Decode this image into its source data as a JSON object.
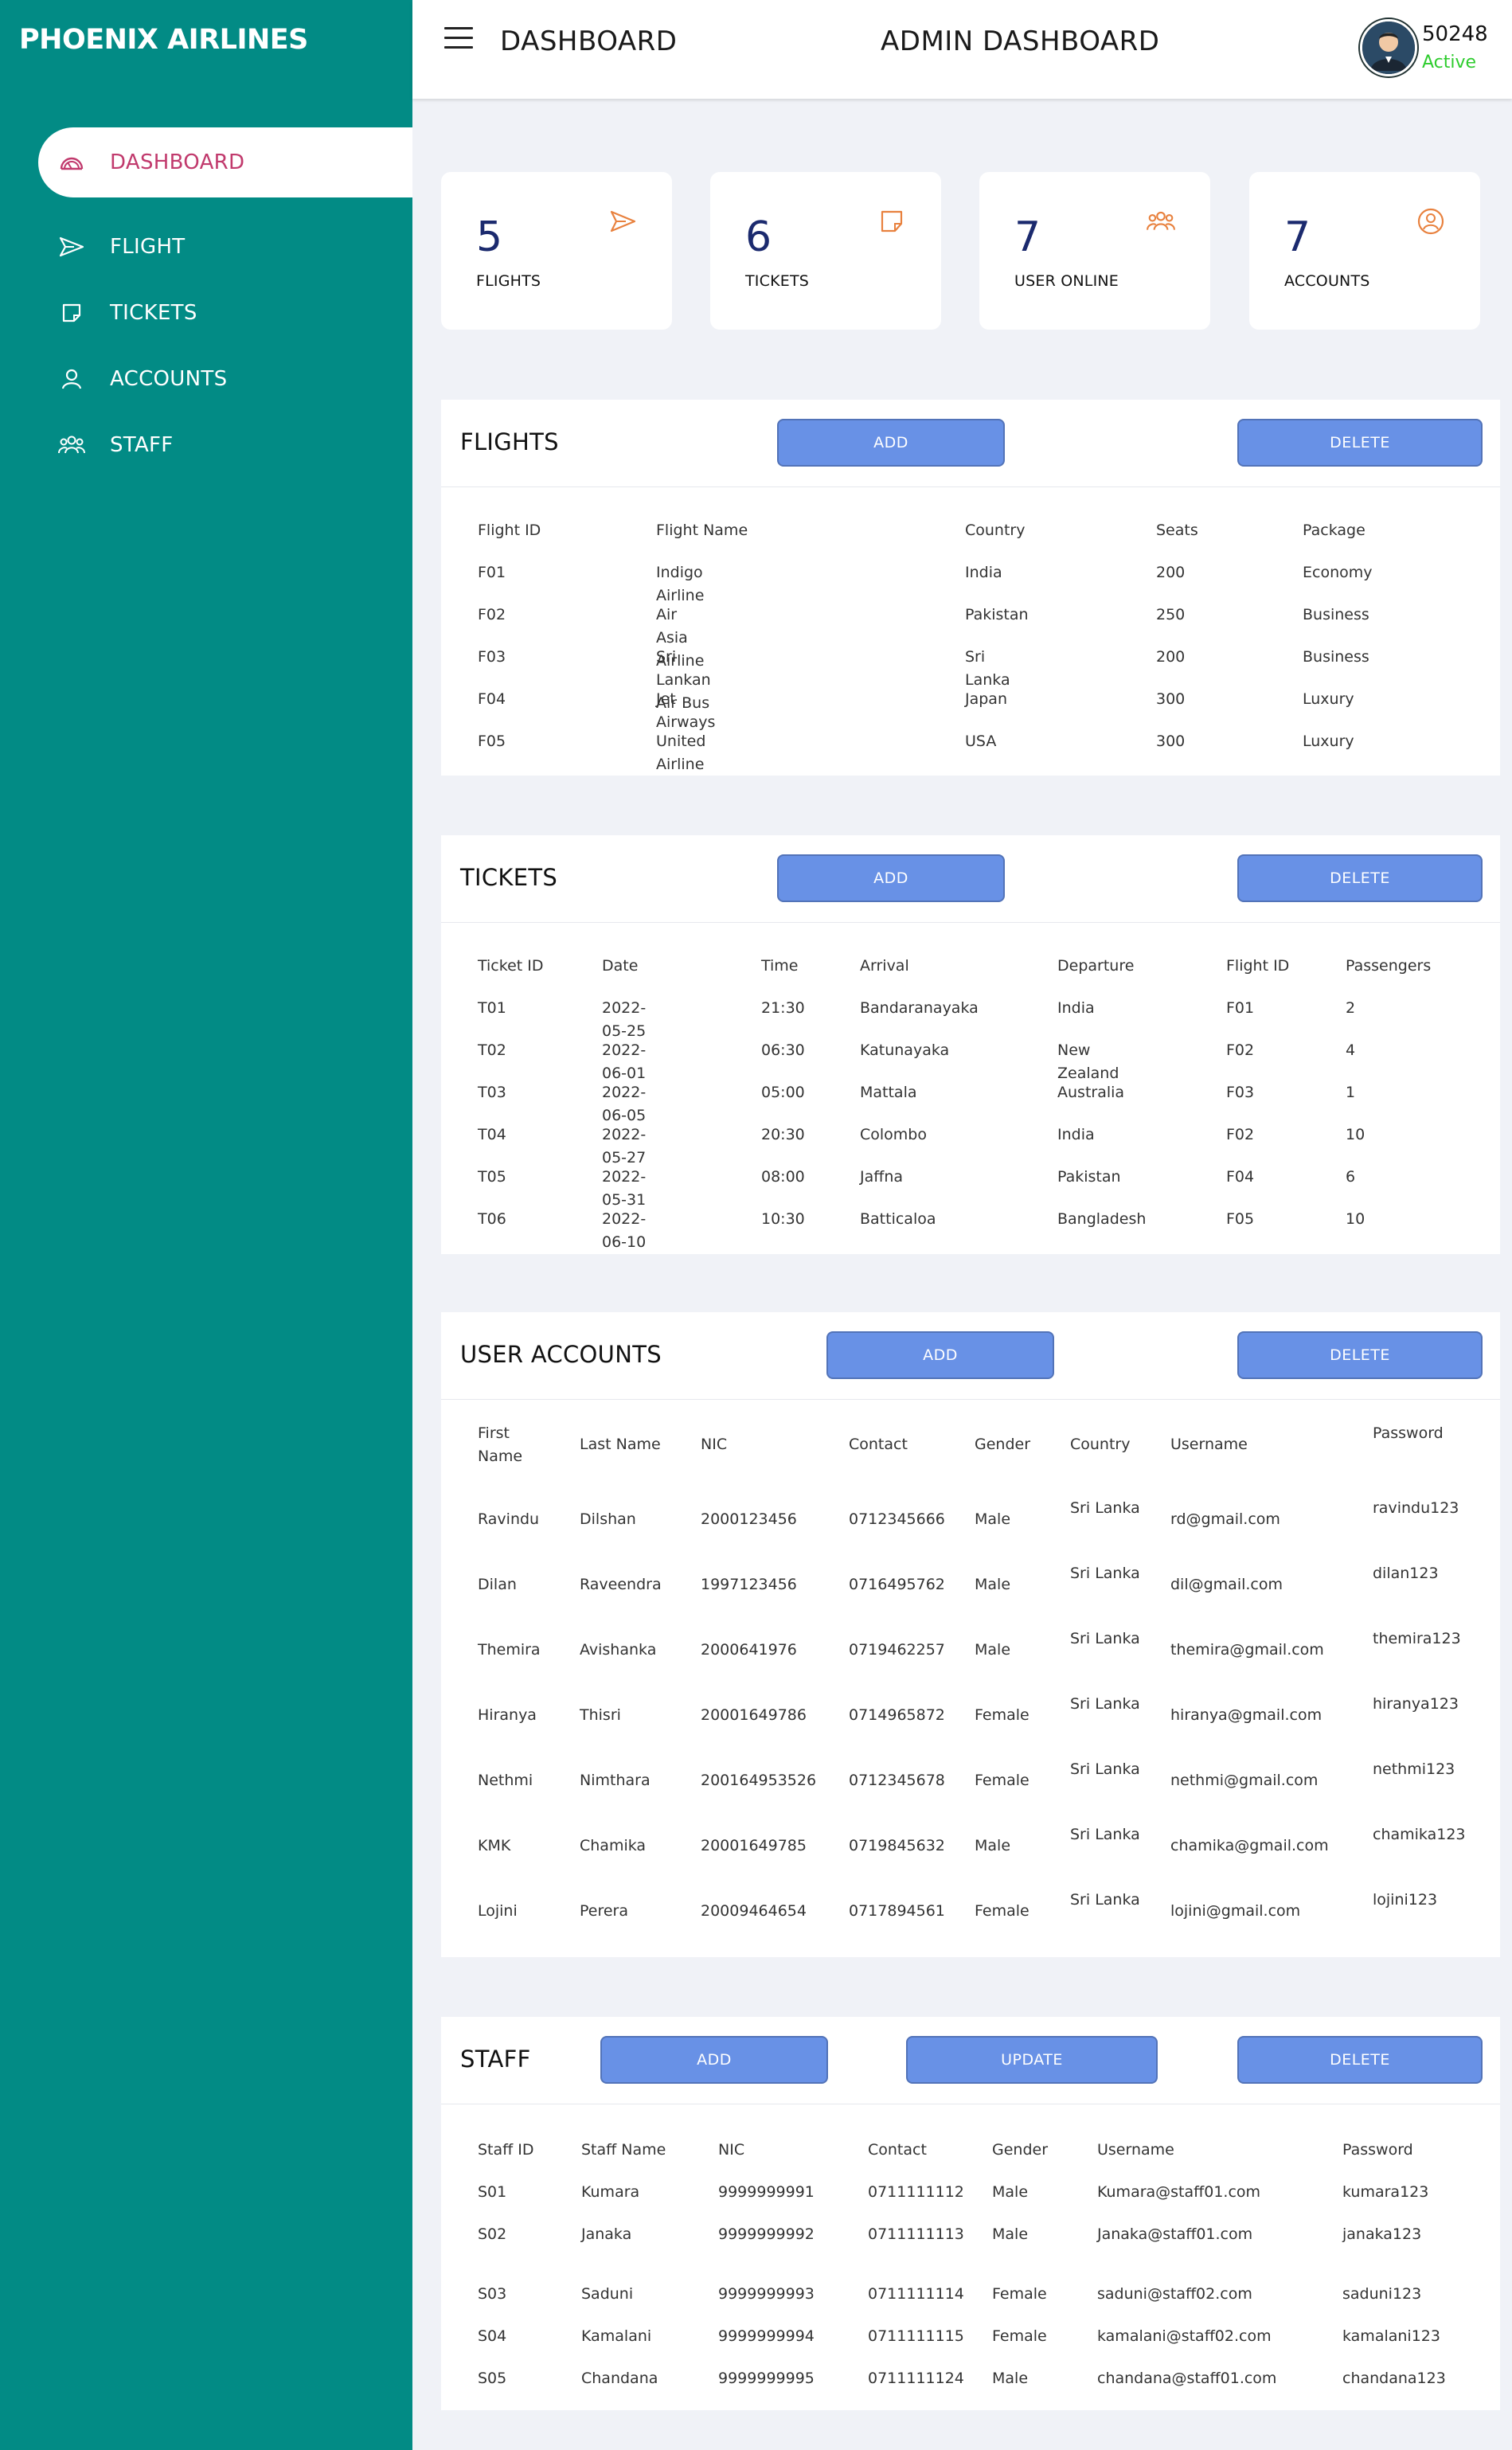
{
  "brand": "PHOENIX AIRLINES",
  "colors": {
    "sidebar": "#028b85",
    "accent": "#c13a6d",
    "button": "#6891e6",
    "status": "#2ecc2e",
    "card_number": "#1b2a6e",
    "card_icon": "#e8813e"
  },
  "sidebar": {
    "items": [
      {
        "label": "DASHBOARD",
        "icon": "dashboard-icon",
        "active": true
      },
      {
        "label": "FLIGHT",
        "icon": "plane-icon",
        "active": false
      },
      {
        "label": "TICKETS",
        "icon": "ticket-icon",
        "active": false
      },
      {
        "label": "ACCOUNTS",
        "icon": "user-icon",
        "active": false
      },
      {
        "label": "STAFF",
        "icon": "group-icon",
        "active": false
      }
    ]
  },
  "header": {
    "menu_icon": "hamburger-icon",
    "title": "DASHBOARD",
    "center_title": "ADMIN DASHBOARD",
    "user": {
      "id": "50248",
      "status": "Active",
      "avatar": "avatar-icon"
    }
  },
  "cards": [
    {
      "number": "5",
      "label": "FLIGHTS",
      "icon": "plane-icon"
    },
    {
      "number": "6",
      "label": "TICKETS",
      "icon": "ticket-icon"
    },
    {
      "number": "7",
      "label": "USER ONLINE",
      "icon": "group-icon"
    },
    {
      "number": "7",
      "label": "ACCOUNTS",
      "icon": "user-circle-icon"
    }
  ],
  "flights": {
    "title": "FLIGHTS",
    "add_label": "ADD",
    "delete_label": "DELETE",
    "columns": [
      "Flight ID",
      "Flight Name",
      "Country",
      "Seats",
      "Package"
    ],
    "rows": [
      [
        "F01",
        "Indigo Airline",
        "India",
        "200",
        "Economy"
      ],
      [
        "F02",
        "Air Asia Airline",
        "Pakistan",
        "250",
        "Business"
      ],
      [
        "F03",
        "Sri Lankan Air Bus",
        "Sri Lanka",
        "200",
        "Business"
      ],
      [
        "F04",
        "Jet Airways",
        "Japan",
        "300",
        "Luxury"
      ],
      [
        "F05",
        "United Airline",
        "USA",
        "300",
        "Luxury"
      ]
    ]
  },
  "tickets": {
    "title": "TICKETS",
    "add_label": "ADD",
    "delete_label": "DELETE",
    "columns": [
      "Ticket ID",
      "Date",
      "Time",
      "Arrival",
      "Departure",
      "Flight ID",
      "Passengers"
    ],
    "rows": [
      [
        "T01",
        "2022-05-25",
        "21:30",
        "Bandaranayaka",
        "India",
        "F01",
        "2"
      ],
      [
        "T02",
        "2022-06-01",
        "06:30",
        "Katunayaka",
        "New Zealand",
        "F02",
        "4"
      ],
      [
        "T03",
        "2022-06-05",
        "05:00",
        "Mattala",
        "Australia",
        "F03",
        "1"
      ],
      [
        "T04",
        "2022-05-27",
        "20:30",
        "Colombo",
        "India",
        "F02",
        "10"
      ],
      [
        "T05",
        "2022-05-31",
        "08:00",
        "Jaffna",
        "Pakistan",
        "F04",
        "6"
      ],
      [
        "T06",
        "2022-06-10",
        "10:30",
        "Batticaloa",
        "Bangladesh",
        "F05",
        "10"
      ]
    ]
  },
  "accounts": {
    "title": "USER ACCOUNTS",
    "add_label": "ADD",
    "delete_label": "DELETE",
    "columns": [
      "First Name",
      "Last Name",
      "NIC",
      "Contact",
      "Gender",
      "Country",
      "Username",
      "Password"
    ],
    "rows": [
      [
        "Ravindu",
        "Dilshan",
        "2000123456",
        "0712345666",
        "Male",
        "Sri Lanka",
        "rd@gmail.com",
        "ravindu123"
      ],
      [
        "Dilan",
        "Raveendra",
        "1997123456",
        "0716495762",
        "Male",
        "Sri Lanka",
        "dil@gmail.com",
        "dilan123"
      ],
      [
        "Themira",
        "Avishanka",
        "2000641976",
        "0719462257",
        "Male",
        "Sri Lanka",
        "themira@gmail.com",
        "themira123"
      ],
      [
        "Hiranya",
        "Thisri",
        "20001649786",
        "0714965872",
        "Female",
        "Sri Lanka",
        "hiranya@gmail.com",
        "hiranya123"
      ],
      [
        "Nethmi",
        "Nimthara",
        "200164953526",
        "0712345678",
        "Female",
        "Sri Lanka",
        "nethmi@gmail.com",
        "nethmi123"
      ],
      [
        "KMK",
        "Chamika",
        "20001649785",
        "0719845632",
        "Male",
        "Sri Lanka",
        "chamika@gmail.com",
        "chamika123"
      ],
      [
        "Lojini",
        "Perera",
        "20009464654",
        "0717894561",
        "Female",
        "Sri Lanka",
        "lojini@gmail.com",
        "lojini123"
      ]
    ]
  },
  "staff": {
    "title": "STAFF",
    "add_label": "ADD",
    "update_label": "UPDATE",
    "delete_label": "DELETE",
    "columns": [
      "Staff ID",
      "Staff Name",
      "NIC",
      "Contact",
      "Gender",
      "Username",
      "Password"
    ],
    "rows": [
      [
        "S01",
        "Kumara",
        "9999999991",
        "0711111112",
        "Male",
        "Kumara@staff01.com",
        "kumara123"
      ],
      [
        "S02",
        "Janaka",
        "9999999992",
        "0711111113",
        "Male",
        "Janaka@staff01.com",
        "janaka123"
      ],
      [
        "S03",
        "Saduni",
        "9999999993",
        "0711111114",
        "Female",
        "saduni@staff02.com",
        "saduni123"
      ],
      [
        "S04",
        "Kamalani",
        "9999999994",
        "0711111115",
        "Female",
        "kamalani@staff02.com",
        "kamalani123"
      ],
      [
        "S05",
        "Chandana",
        "9999999995",
        "0711111124",
        "Male",
        "chandana@staff01.com",
        "chandana123"
      ]
    ]
  }
}
